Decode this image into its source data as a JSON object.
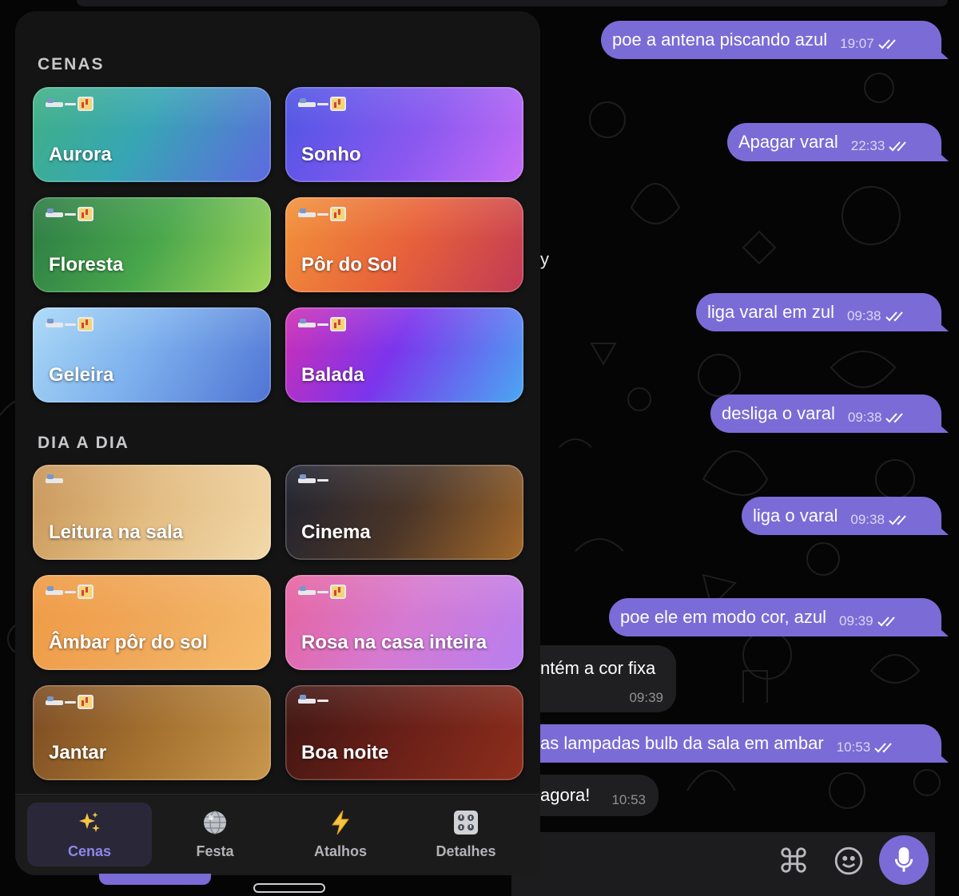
{
  "panel": {
    "sections": [
      {
        "title": "CENAS",
        "cards": [
          {
            "label": "Aurora",
            "icons": [
              "bed",
              "line",
              "chart"
            ]
          },
          {
            "label": "Sonho",
            "icons": [
              "bed",
              "line",
              "chart"
            ]
          },
          {
            "label": "Floresta",
            "icons": [
              "bed",
              "line",
              "chart"
            ]
          },
          {
            "label": "Pôr do Sol",
            "icons": [
              "bed",
              "line",
              "chart"
            ]
          },
          {
            "label": "Geleira",
            "icons": [
              "bed",
              "line",
              "chart"
            ]
          },
          {
            "label": "Balada",
            "icons": [
              "bed",
              "line",
              "chart"
            ]
          }
        ]
      },
      {
        "title": "DIA A DIA",
        "cards": [
          {
            "label": "Leitura na sala",
            "icons": [
              "bed"
            ]
          },
          {
            "label": "Cinema",
            "icons": [
              "bed",
              "line"
            ]
          },
          {
            "label": "Âmbar pôr do sol",
            "icons": [
              "bed",
              "line",
              "chart"
            ]
          },
          {
            "label": "Rosa na casa inteira",
            "icons": [
              "bed",
              "line",
              "chart"
            ]
          },
          {
            "label": "Jantar",
            "icons": [
              "bed",
              "line",
              "chart"
            ]
          },
          {
            "label": "Boa noite",
            "icons": [
              "bed",
              "line"
            ]
          }
        ]
      }
    ],
    "tabs": [
      {
        "label": "Cenas",
        "icon": "sparkles-icon",
        "active": true
      },
      {
        "label": "Festa",
        "icon": "disco-ball-icon",
        "active": false
      },
      {
        "label": "Atalhos",
        "icon": "lightning-icon",
        "active": false
      },
      {
        "label": "Detalhes",
        "icon": "control-knobs-icon",
        "active": false
      }
    ]
  },
  "chat": {
    "outgoing": [
      {
        "text": "poe a antena piscando azul",
        "time": "19:07"
      },
      {
        "text": "Apagar varal",
        "time": "22:33"
      },
      {
        "text": "liga varal em zul",
        "time": "09:38"
      },
      {
        "text": "desliga o varal",
        "time": "09:38"
      },
      {
        "text": "liga o varal",
        "time": "09:38"
      },
      {
        "text": "poe ele em modo cor, azul",
        "time": "09:39"
      },
      {
        "text": "as lampadas bulb da sala em ambar",
        "time": "10:53"
      }
    ],
    "incoming": [
      {
        "text": "ntém a cor fixa",
        "time": "09:39"
      },
      {
        "text": "agora!",
        "time": "10:53"
      }
    ],
    "stray_text": "y",
    "composer_icons": [
      "command-icon",
      "emoji-icon",
      "microphone-icon"
    ]
  },
  "colors": {
    "bubble_out": "#7b6bd6",
    "tab_active": "#8f86ea",
    "panel_bg": "#141414"
  }
}
